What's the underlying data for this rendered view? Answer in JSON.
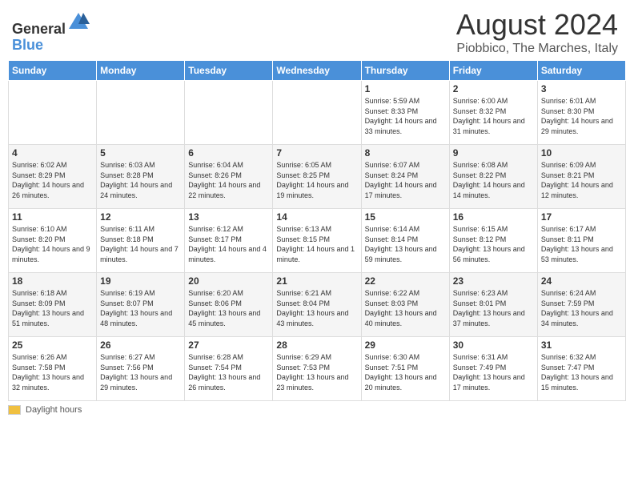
{
  "header": {
    "logo_general": "General",
    "logo_blue": "Blue",
    "month_year": "August 2024",
    "location": "Piobbico, The Marches, Italy"
  },
  "calendar": {
    "days_of_week": [
      "Sunday",
      "Monday",
      "Tuesday",
      "Wednesday",
      "Thursday",
      "Friday",
      "Saturday"
    ],
    "weeks": [
      [
        {
          "day": "",
          "info": ""
        },
        {
          "day": "",
          "info": ""
        },
        {
          "day": "",
          "info": ""
        },
        {
          "day": "",
          "info": ""
        },
        {
          "day": "1",
          "info": "Sunrise: 5:59 AM\nSunset: 8:33 PM\nDaylight: 14 hours and 33 minutes."
        },
        {
          "day": "2",
          "info": "Sunrise: 6:00 AM\nSunset: 8:32 PM\nDaylight: 14 hours and 31 minutes."
        },
        {
          "day": "3",
          "info": "Sunrise: 6:01 AM\nSunset: 8:30 PM\nDaylight: 14 hours and 29 minutes."
        }
      ],
      [
        {
          "day": "4",
          "info": "Sunrise: 6:02 AM\nSunset: 8:29 PM\nDaylight: 14 hours and 26 minutes."
        },
        {
          "day": "5",
          "info": "Sunrise: 6:03 AM\nSunset: 8:28 PM\nDaylight: 14 hours and 24 minutes."
        },
        {
          "day": "6",
          "info": "Sunrise: 6:04 AM\nSunset: 8:26 PM\nDaylight: 14 hours and 22 minutes."
        },
        {
          "day": "7",
          "info": "Sunrise: 6:05 AM\nSunset: 8:25 PM\nDaylight: 14 hours and 19 minutes."
        },
        {
          "day": "8",
          "info": "Sunrise: 6:07 AM\nSunset: 8:24 PM\nDaylight: 14 hours and 17 minutes."
        },
        {
          "day": "9",
          "info": "Sunrise: 6:08 AM\nSunset: 8:22 PM\nDaylight: 14 hours and 14 minutes."
        },
        {
          "day": "10",
          "info": "Sunrise: 6:09 AM\nSunset: 8:21 PM\nDaylight: 14 hours and 12 minutes."
        }
      ],
      [
        {
          "day": "11",
          "info": "Sunrise: 6:10 AM\nSunset: 8:20 PM\nDaylight: 14 hours and 9 minutes."
        },
        {
          "day": "12",
          "info": "Sunrise: 6:11 AM\nSunset: 8:18 PM\nDaylight: 14 hours and 7 minutes."
        },
        {
          "day": "13",
          "info": "Sunrise: 6:12 AM\nSunset: 8:17 PM\nDaylight: 14 hours and 4 minutes."
        },
        {
          "day": "14",
          "info": "Sunrise: 6:13 AM\nSunset: 8:15 PM\nDaylight: 14 hours and 1 minute."
        },
        {
          "day": "15",
          "info": "Sunrise: 6:14 AM\nSunset: 8:14 PM\nDaylight: 13 hours and 59 minutes."
        },
        {
          "day": "16",
          "info": "Sunrise: 6:15 AM\nSunset: 8:12 PM\nDaylight: 13 hours and 56 minutes."
        },
        {
          "day": "17",
          "info": "Sunrise: 6:17 AM\nSunset: 8:11 PM\nDaylight: 13 hours and 53 minutes."
        }
      ],
      [
        {
          "day": "18",
          "info": "Sunrise: 6:18 AM\nSunset: 8:09 PM\nDaylight: 13 hours and 51 minutes."
        },
        {
          "day": "19",
          "info": "Sunrise: 6:19 AM\nSunset: 8:07 PM\nDaylight: 13 hours and 48 minutes."
        },
        {
          "day": "20",
          "info": "Sunrise: 6:20 AM\nSunset: 8:06 PM\nDaylight: 13 hours and 45 minutes."
        },
        {
          "day": "21",
          "info": "Sunrise: 6:21 AM\nSunset: 8:04 PM\nDaylight: 13 hours and 43 minutes."
        },
        {
          "day": "22",
          "info": "Sunrise: 6:22 AM\nSunset: 8:03 PM\nDaylight: 13 hours and 40 minutes."
        },
        {
          "day": "23",
          "info": "Sunrise: 6:23 AM\nSunset: 8:01 PM\nDaylight: 13 hours and 37 minutes."
        },
        {
          "day": "24",
          "info": "Sunrise: 6:24 AM\nSunset: 7:59 PM\nDaylight: 13 hours and 34 minutes."
        }
      ],
      [
        {
          "day": "25",
          "info": "Sunrise: 6:26 AM\nSunset: 7:58 PM\nDaylight: 13 hours and 32 minutes."
        },
        {
          "day": "26",
          "info": "Sunrise: 6:27 AM\nSunset: 7:56 PM\nDaylight: 13 hours and 29 minutes."
        },
        {
          "day": "27",
          "info": "Sunrise: 6:28 AM\nSunset: 7:54 PM\nDaylight: 13 hours and 26 minutes."
        },
        {
          "day": "28",
          "info": "Sunrise: 6:29 AM\nSunset: 7:53 PM\nDaylight: 13 hours and 23 minutes."
        },
        {
          "day": "29",
          "info": "Sunrise: 6:30 AM\nSunset: 7:51 PM\nDaylight: 13 hours and 20 minutes."
        },
        {
          "day": "30",
          "info": "Sunrise: 6:31 AM\nSunset: 7:49 PM\nDaylight: 13 hours and 17 minutes."
        },
        {
          "day": "31",
          "info": "Sunrise: 6:32 AM\nSunset: 7:47 PM\nDaylight: 13 hours and 15 minutes."
        }
      ]
    ]
  },
  "footer": {
    "daylight_label": "Daylight hours"
  }
}
